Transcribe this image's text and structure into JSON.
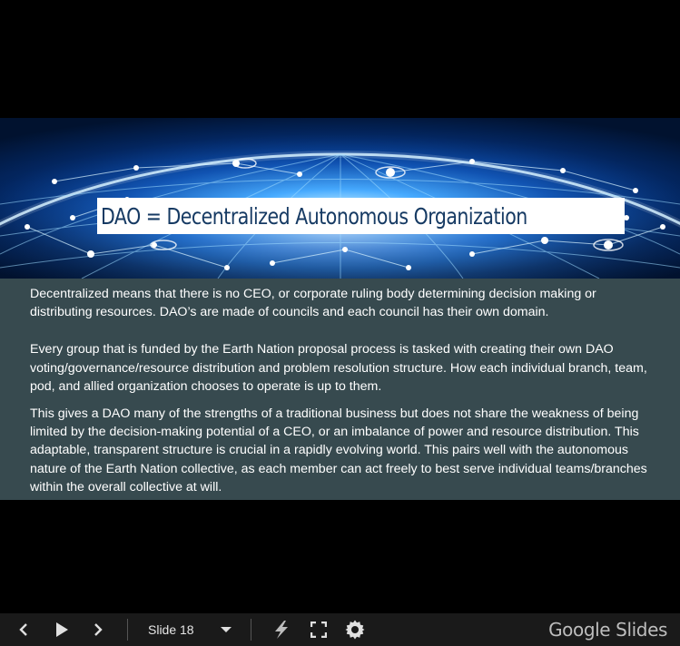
{
  "slide": {
    "title": "DAO = Decentralized Autonomous Organization",
    "paragraphs": [
      "Decentralized means that there is no CEO, or corporate ruling body determining decision making or distributing resources. DAO’s are made of councils and each council has their own domain.",
      "Every group that is funded by the Earth Nation proposal process is tasked with creating their own DAO voting/governance/resource distribution and problem resolution structure. How each individual branch, team, pod, and allied organization chooses to operate is up to them.",
      "This gives a DAO many of the strengths of a traditional business but does not share the weakness of being limited by the decision-making potential of a CEO, or an imbalance of power and resource distribution.  This adaptable, transparent structure is crucial in a rapidly evolving world. This pairs well with the autonomous nature of the Earth Nation collective, as each member can act freely to best serve individual teams/branches within the overall collective at will."
    ]
  },
  "toolbar": {
    "slide_indicator": "Slide 18",
    "icons": [
      "chevron-left-icon",
      "play-icon",
      "chevron-right-icon",
      "dropdown-arrow-icon",
      "laser-pointer-icon",
      "fullscreen-icon",
      "settings-gear-icon"
    ],
    "logo": "Google Slides"
  },
  "colors": {
    "background": "#000000",
    "slide_body": "#374a4f",
    "toolbar": "#1a1a1a",
    "title_text": "#163a63"
  }
}
